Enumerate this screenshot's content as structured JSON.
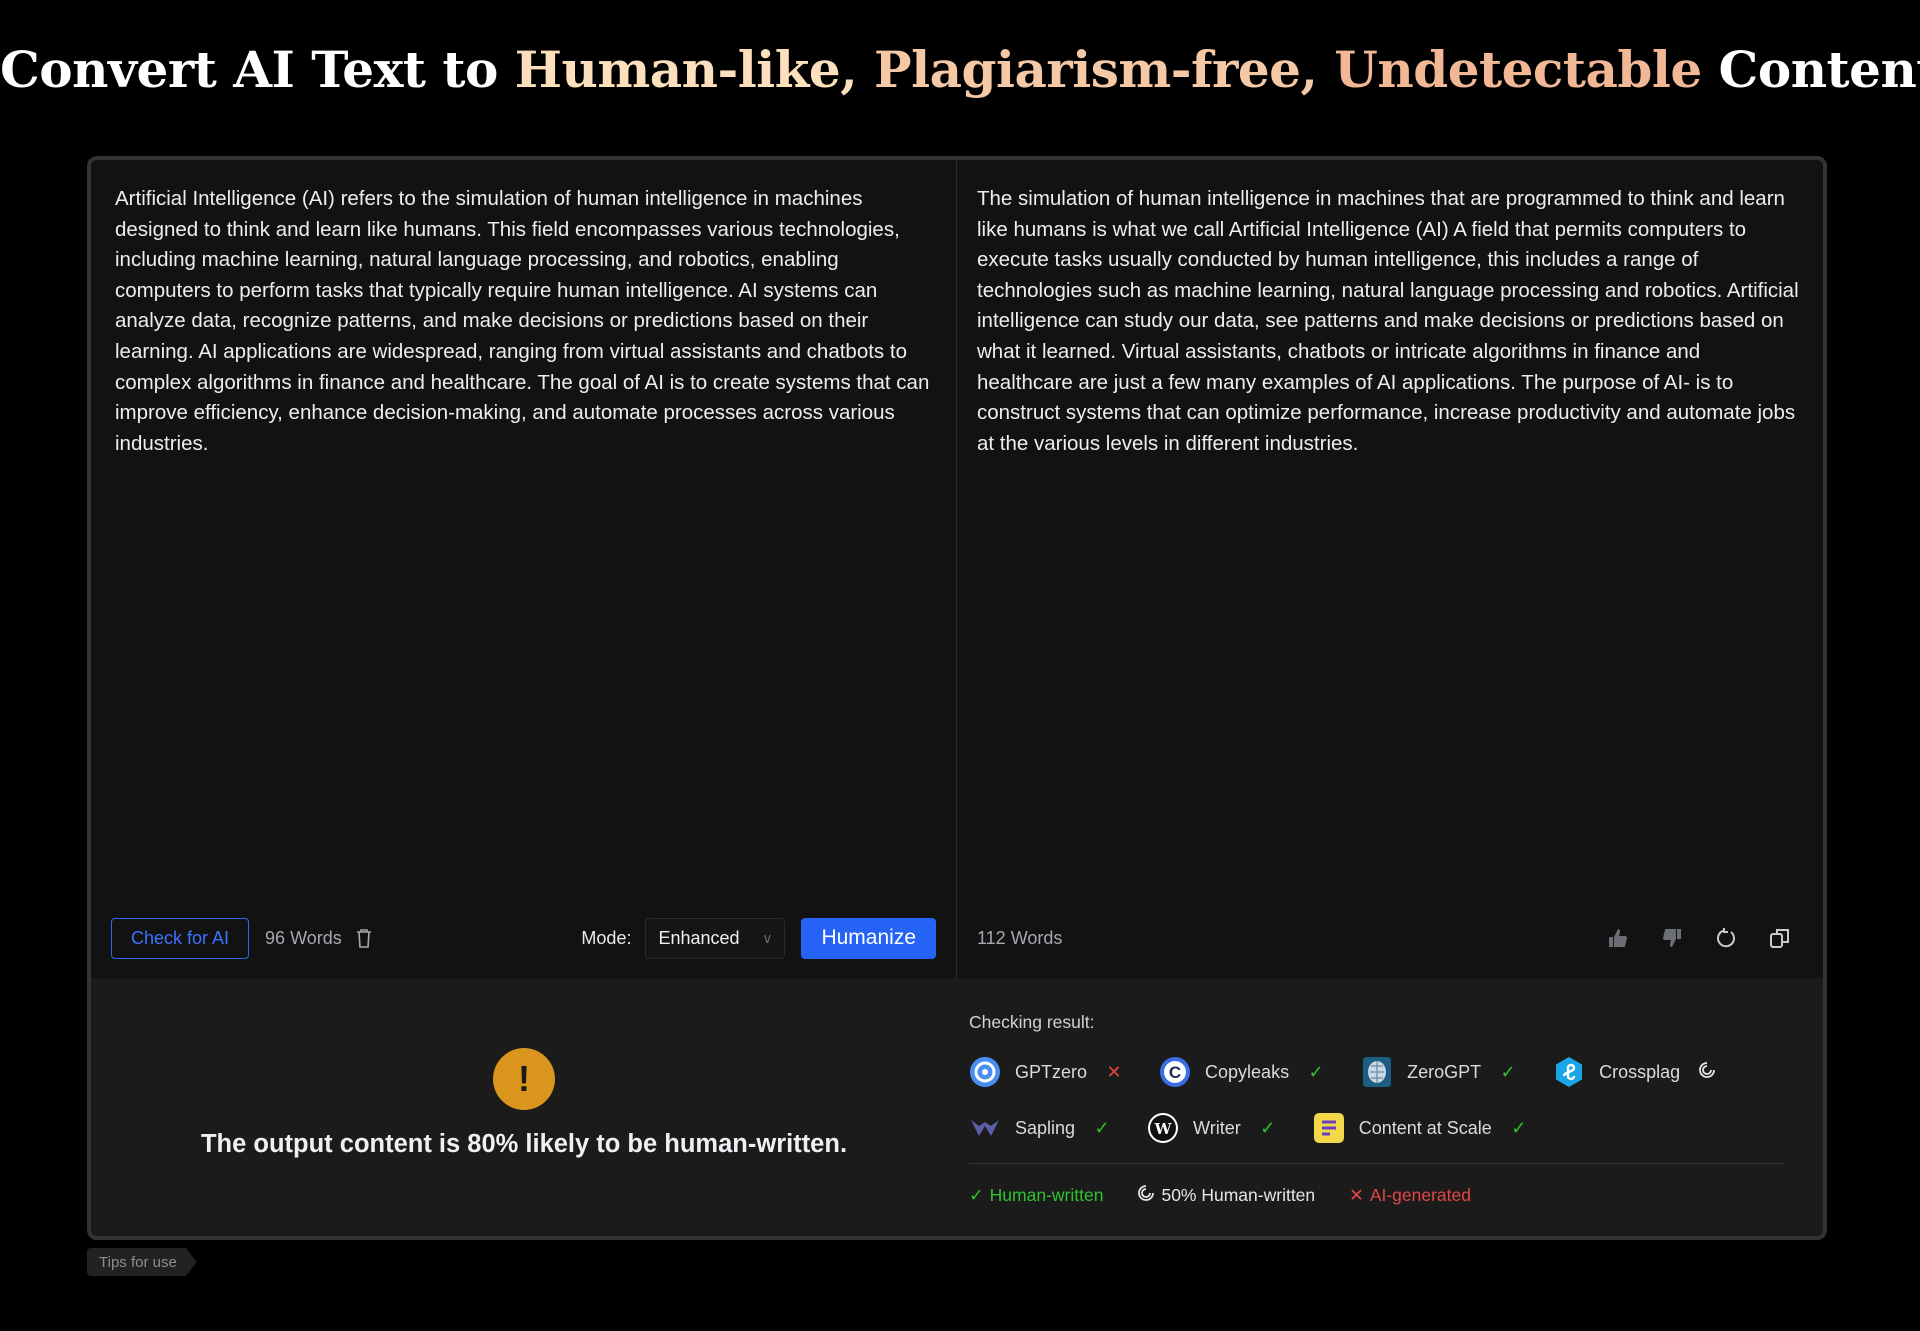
{
  "headline": {
    "part1": "Convert AI Text to ",
    "highlight1": "Human-like, ",
    "highlight2": "Plagiarism-free, ",
    "highlight3": "Undetectable",
    "part2": " Content"
  },
  "input_pane": {
    "text": "Artificial Intelligence (AI) refers to the simulation of human intelligence in machines designed to think and learn like humans. This field encompasses various technologies, including machine learning, natural language processing, and robotics, enabling computers to perform tasks that typically require human intelligence. AI systems can analyze data, recognize patterns, and make decisions or predictions based on their learning. AI applications are widespread, ranging from virtual assistants and chatbots to complex algorithms in finance and healthcare. The goal of AI is to create systems that can improve efficiency, enhance decision-making, and automate processes across various industries.",
    "check_button": "Check for AI",
    "word_count": "96 Words",
    "mode_label": "Mode:",
    "mode_value": "Enhanced",
    "humanize_button": "Humanize"
  },
  "output_pane": {
    "text": "The simulation of human intelligence in machines that are programmed to think and learn like humans is what we call Artificial Intelligence (AI) A field that permits computers to execute tasks usually conducted by human intelligence, this includes a range of technologies such as machine learning, natural language processing and robotics. Artificial intelligence can study our data, see patterns and make decisions or predictions based on what it learned. Virtual assistants, chatbots or intricate algorithms in finance and healthcare are just a few many examples of AI applications. The purpose of AI- is to construct systems that can optimize performance, increase productivity and automate jobs at the various levels in different industries.",
    "word_count": "112 Words",
    "actions": [
      "thumbs-up-icon",
      "thumbs-down-icon",
      "regenerate-icon",
      "copy-icon"
    ]
  },
  "result": {
    "verdict": "The output content is 80% likely to be human-written.",
    "icon": "warning-icon",
    "warning_color": "#d9951c",
    "checking_title": "Checking result:",
    "detectors": [
      {
        "name": "GPTzero",
        "status": "ai",
        "status_glyph": "✕"
      },
      {
        "name": "Copyleaks",
        "status": "human",
        "status_glyph": "✓"
      },
      {
        "name": "ZeroGPT",
        "status": "human",
        "status_glyph": "✓"
      },
      {
        "name": "Crossplag",
        "status": "half",
        "status_glyph": "◌"
      },
      {
        "name": "Sapling",
        "status": "human",
        "status_glyph": "✓"
      },
      {
        "name": "Writer",
        "status": "human",
        "status_glyph": "✓"
      },
      {
        "name": "Content at Scale",
        "status": "human",
        "status_glyph": "✓"
      }
    ],
    "legend": [
      {
        "label": "Human-written",
        "glyph": "✓",
        "color": "#2fc12f"
      },
      {
        "label": "50% Human-written",
        "glyph": "◌",
        "color": "#e6e6e6"
      },
      {
        "label": "AI-generated",
        "glyph": "✕",
        "color": "#e04646"
      }
    ]
  },
  "tips_tab": "Tips for use",
  "colors": {
    "accent": "#2563f5",
    "human": "#2fc12f",
    "ai": "#e04646"
  }
}
